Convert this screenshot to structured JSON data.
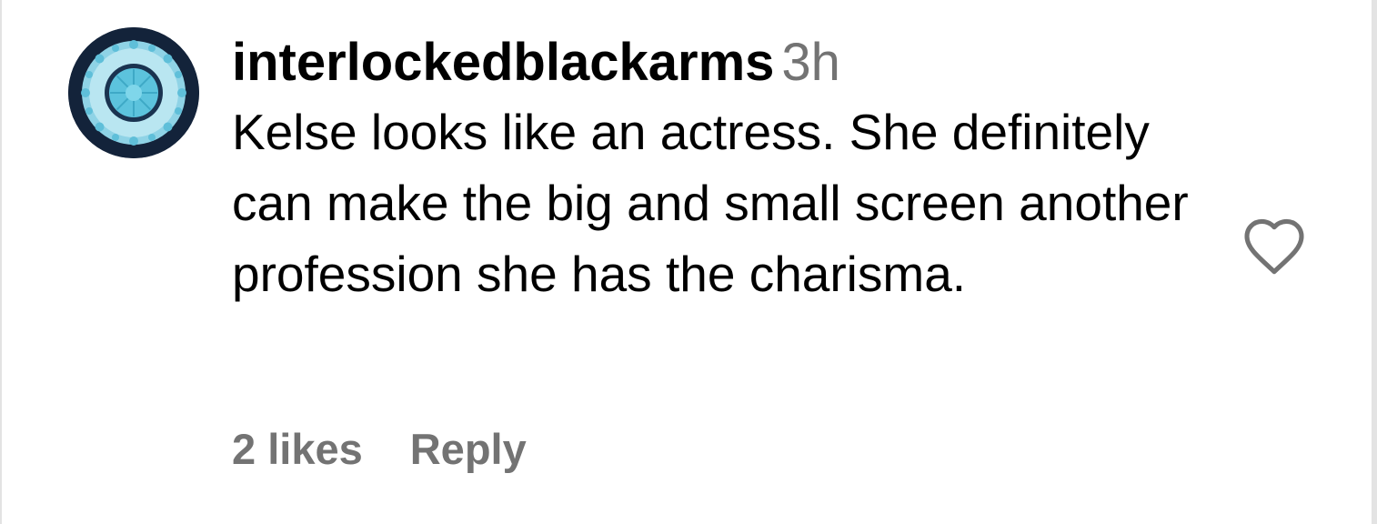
{
  "comment": {
    "username": "interlockedblackarms",
    "time": "3h",
    "text": "Kelse looks like an actress. She definitely can make the big and small screen another profession she has the charisma.",
    "likes_label": "2 likes",
    "reply_label": "Reply"
  },
  "icons": {
    "avatar": "avatar-image",
    "like": "heart-outline-icon"
  },
  "colors": {
    "secondary_text": "#737373",
    "avatar_ring": "#13233a",
    "avatar_accent": "#7fd0e6"
  }
}
